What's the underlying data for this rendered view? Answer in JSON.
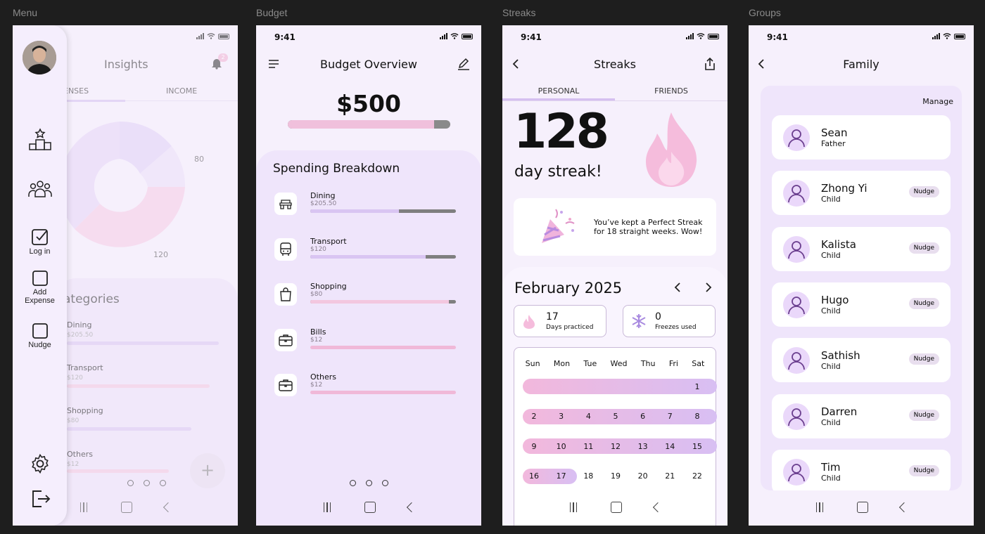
{
  "frames": {
    "menu": "Menu",
    "budget": "Budget",
    "streaks": "Streaks",
    "groups": "Groups"
  },
  "status": {
    "time": "9:41"
  },
  "menu": {
    "bg_title": "Insights",
    "bell_badge": "2",
    "bg_tabs": [
      "ENSES",
      "INCOME"
    ],
    "donut_labels": [
      "80",
      "120"
    ],
    "bg_categories_title": "ategories",
    "bg_categories": [
      {
        "name": "Dining",
        "value": "$205.50"
      },
      {
        "name": "Transport",
        "value": "$120"
      },
      {
        "name": "Shopping",
        "value": "$80"
      },
      {
        "name": "Others",
        "value": "$12"
      }
    ],
    "drawer": {
      "log_in": "Log in",
      "add_expense_1": "Add",
      "add_expense_2": "Expense",
      "nudge": "Nudge"
    }
  },
  "budget": {
    "title": "Budget Overview",
    "amount": "$500",
    "total_fraction": 0.9,
    "breakdown_title": "Spending Breakdown",
    "items": [
      {
        "name": "Dining",
        "value": "$205.50",
        "fraction": 0.61,
        "color": "#d9c5f2",
        "icon": "dining-icon"
      },
      {
        "name": "Transport",
        "value": "$120",
        "fraction": 0.79,
        "color": "#d9c5f2",
        "icon": "bus-icon"
      },
      {
        "name": "Shopping",
        "value": "$80",
        "fraction": 0.95,
        "color": "#f3c7df",
        "icon": "shopping-bag-icon"
      },
      {
        "name": "Bills",
        "value": "$12",
        "fraction": 1.0,
        "color": "#f0b8d8",
        "icon": "briefcase-icon"
      },
      {
        "name": "Others",
        "value": "$12",
        "fraction": 1.0,
        "color": "#f0b8d8",
        "icon": "briefcase-icon"
      }
    ]
  },
  "streaks": {
    "title": "Streaks",
    "tabs": [
      "PERSONAL",
      "FRIENDS"
    ],
    "count": "128",
    "label": "day streak!",
    "message": "You’ve kept a Perfect Streak for 18 straight weeks. Wow!",
    "month": "February 2025",
    "days_practiced": "17",
    "days_practiced_label": "Days practiced",
    "freezes": "0",
    "freezes_label": "Freezes used",
    "weekdays": [
      "Sun",
      "Mon",
      "Tue",
      "Wed",
      "Thu",
      "Fri",
      "Sat"
    ],
    "weeks": [
      [
        "",
        "",
        "",
        "",
        "",
        "",
        "1"
      ],
      [
        "2",
        "3",
        "4",
        "5",
        "6",
        "7",
        "8"
      ],
      [
        "9",
        "10",
        "11",
        "12",
        "13",
        "14",
        "15"
      ],
      [
        "16",
        "17",
        "18",
        "19",
        "20",
        "21",
        "22"
      ]
    ]
  },
  "groups": {
    "title": "Family",
    "manage": "Manage",
    "nudge_label": "Nudge",
    "members": [
      {
        "name": "Sean",
        "role": "Father"
      },
      {
        "name": "Zhong Yi",
        "role": "Child"
      },
      {
        "name": "Kalista",
        "role": "Child"
      },
      {
        "name": "Hugo",
        "role": "Child"
      },
      {
        "name": "Sathish",
        "role": "Child"
      },
      {
        "name": "Darren",
        "role": "Child"
      },
      {
        "name": "Tim",
        "role": "Child"
      }
    ]
  }
}
